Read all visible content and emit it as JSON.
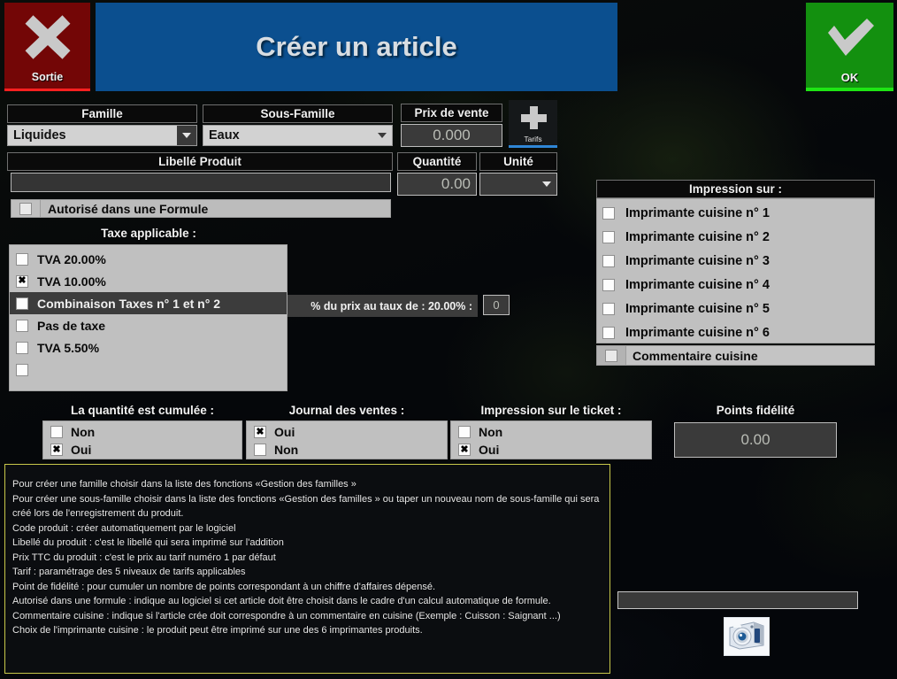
{
  "window": {
    "title": "Créer un article",
    "exit_label": "Sortie",
    "exit_icon": "close-x-icon",
    "ok_label": "OK",
    "ok_icon": "checkmark-icon",
    "header_color": "#0b4f8f",
    "exit_color": "#730606",
    "ok_color": "#13900f"
  },
  "form": {
    "famille": {
      "label": "Famille",
      "value": "Liquides"
    },
    "sous_famille": {
      "label": "Sous-Famille",
      "value": "Eaux"
    },
    "prix_de_vente": {
      "label": "Prix de vente",
      "value": "0.000"
    },
    "tarifs_button": {
      "label": "Tarifs",
      "icon": "plus-icon",
      "accent": "#2f86d6"
    },
    "libelle_produit": {
      "label": "Libellé Produit",
      "value": "",
      "placeholder": ""
    },
    "quantite": {
      "label": "Quantité",
      "value": "0.00"
    },
    "unite": {
      "label": "Unité",
      "value": ""
    },
    "autorise_formule": {
      "label": "Autorisé dans une Formule",
      "checked": false
    }
  },
  "taxes": {
    "caption": "Taxe applicable :",
    "items": [
      {
        "label": "TVA 20.00%",
        "checked": false,
        "highlight": false
      },
      {
        "label": "TVA 10.00%",
        "checked": true,
        "highlight": false
      },
      {
        "label": "Combinaison Taxes n° 1 et n° 2",
        "checked": false,
        "highlight": true
      },
      {
        "label": "Pas de taxe",
        "checked": false,
        "highlight": false
      },
      {
        "label": "TVA 5.50%",
        "checked": false,
        "highlight": false
      },
      {
        "label": "",
        "checked": false,
        "highlight": false
      }
    ],
    "combination": {
      "label": "% du prix au taux de : 20.00% :",
      "value": "0"
    }
  },
  "impression": {
    "header": "Impression sur :",
    "printers": [
      {
        "label": "Imprimante cuisine n° 1",
        "checked": false
      },
      {
        "label": "Imprimante cuisine n° 2",
        "checked": false
      },
      {
        "label": "Imprimante cuisine n° 3",
        "checked": false
      },
      {
        "label": "Imprimante cuisine n° 4",
        "checked": false
      },
      {
        "label": "Imprimante cuisine n° 5",
        "checked": false
      },
      {
        "label": "Imprimante cuisine n° 6",
        "checked": false
      }
    ],
    "commentaire_cuisine": {
      "label": "Commentaire cuisine",
      "checked": false
    }
  },
  "options": {
    "quantite_cumulee": {
      "caption": "La quantité est cumulée :",
      "choices": [
        {
          "label": "Non",
          "checked": false
        },
        {
          "label": "Oui",
          "checked": true
        }
      ]
    },
    "journal_des_ventes": {
      "caption": "Journal des ventes :",
      "choices": [
        {
          "label": "Oui",
          "checked": true
        },
        {
          "label": "Non",
          "checked": false
        }
      ]
    },
    "impression_ticket": {
      "caption": "Impression sur le  ticket :",
      "choices": [
        {
          "label": "Non",
          "checked": false
        },
        {
          "label": "Oui",
          "checked": true
        }
      ]
    },
    "points_fidelite": {
      "caption": "Points fidélité",
      "value": "0.00"
    }
  },
  "help": {
    "border_color": "#c8c84a",
    "lines": [
      "Pour créer une famille choisir dans la liste des fonctions «Gestion des familles »",
      "Pour créer une sous-famille choisir dans la liste des fonctions «Gestion des familles » ou taper un nouveau nom de sous-famille qui sera créé lors de l'enregistrement du produit.",
      "Code produit : créer automatiquement par le logiciel",
      "Libellé du produit : c'est le libellé qui sera imprimé sur l'addition",
      "Prix TTC du produit : c'est le prix au tarif numéro 1 par défaut",
      "Tarif : paramétrage des 5 niveaux de tarifs applicables",
      "Point de fidélité : pour cumuler un nombre de points correspondant à un chiffre d'affaires dépensé.",
      "Autorisé dans une formule : indique au logiciel si cet article doit être choisit dans le cadre d'un calcul automatique de formule.",
      "Commentaire cuisine : indique si l'article crée doit correspondre à un commentaire en cuisine (Exemple : Cuisson : Saignant ...)",
      "Choix de l'imprimante cuisine : le produit peut être imprimé sur une des 6 imprimantes produits."
    ]
  },
  "photo": {
    "path_value": "",
    "camera_icon": "camera-icon"
  }
}
